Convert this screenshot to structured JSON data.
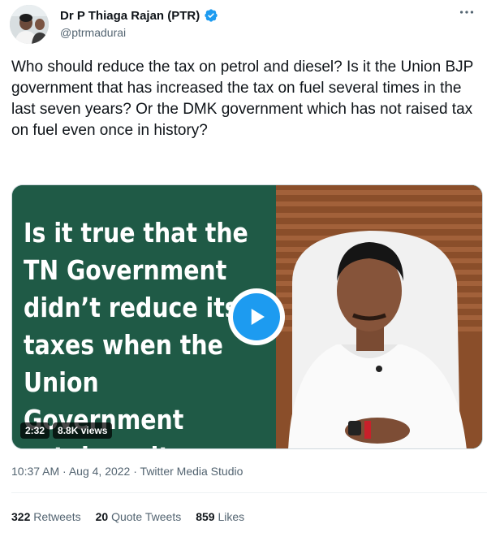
{
  "author": {
    "display_name": "Dr P Thiaga Rajan (PTR)",
    "handle": "@ptrmadurai",
    "verified": true,
    "avatar_icon": "profile-photo"
  },
  "more_icon": "more-horizontal-icon",
  "tweet": {
    "text": "Who should reduce the tax on petrol and diesel? Is it the Union BJP government that has increased the tax on fuel several times in the last seven years? Or the DMK government which has not raised tax on fuel even once in history?"
  },
  "media": {
    "overlay_text": "Is it true that the\nTN Government\ndidn’t reduce its\ntaxes when the\nUnion Government\ncut down its taxes ?",
    "duration": "2:32",
    "views": "8.8K views",
    "play_icon": "play-icon"
  },
  "meta": {
    "time": "10:37 AM",
    "sep1": " · ",
    "date": "Aug 4, 2022",
    "sep2": " · ",
    "source": "Twitter Media Studio"
  },
  "stats": {
    "retweets_count": "322",
    "retweets_label": "Retweets",
    "quotes_count": "20",
    "quotes_label": "Quote Tweets",
    "likes_count": "859",
    "likes_label": "Likes"
  },
  "colors": {
    "verified_blue": "#1d9bf0",
    "play_blue": "#1d9bf0",
    "media_green": "#1f5a46",
    "text_primary": "#0f1419",
    "text_secondary": "#536471"
  }
}
